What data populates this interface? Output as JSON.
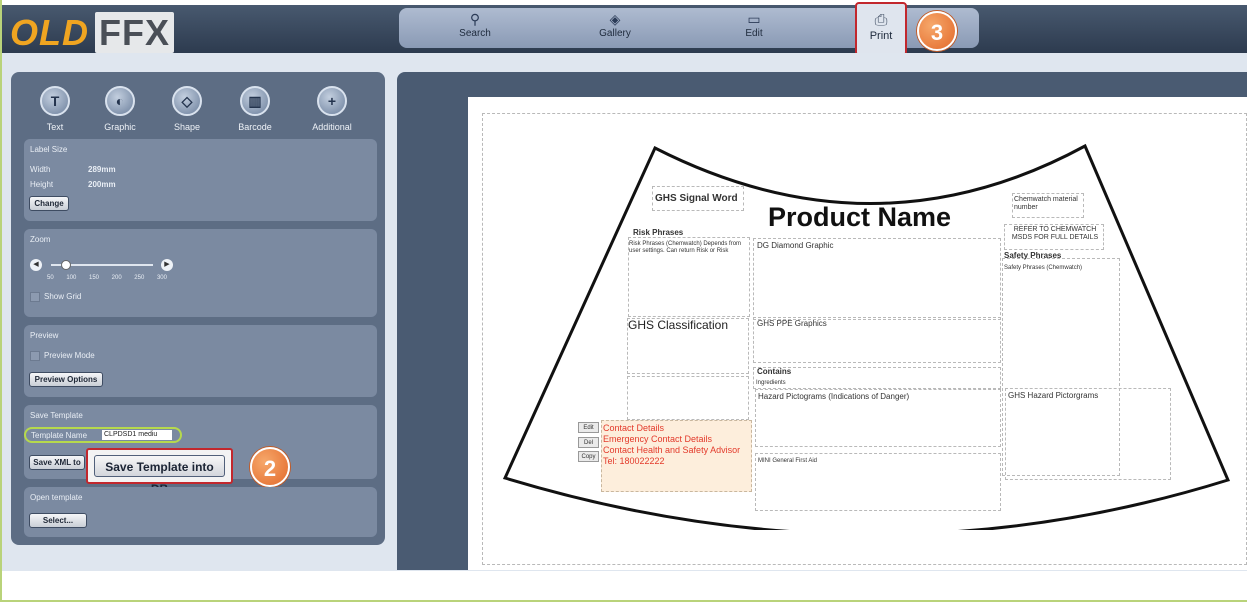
{
  "app": {
    "logo_part1": "OLD",
    "logo_part2": "FFX"
  },
  "nav": [
    {
      "label": "Search",
      "icon": "search-icon"
    },
    {
      "label": "Gallery",
      "icon": "gallery-icon"
    },
    {
      "label": "Edit",
      "icon": "edit-icon"
    }
  ],
  "print": {
    "label": "Print",
    "icon": "printer-icon"
  },
  "badges": {
    "two": "2",
    "three": "3"
  },
  "tools": [
    "Text",
    "Graphic",
    "Shape",
    "Barcode",
    "Additional"
  ],
  "label_size": {
    "title": "Label Size",
    "width_label": "Width",
    "width_value": "289mm",
    "height_label": "Height",
    "height_value": "200mm",
    "change_button": "Change"
  },
  "zoom": {
    "title": "Zoom",
    "ticks": [
      "50",
      "100",
      "150",
      "200",
      "250",
      "300"
    ],
    "show_grid": "Show Grid"
  },
  "preview": {
    "title": "Preview",
    "mode": "Preview Mode",
    "options_button": "Preview Options"
  },
  "save_template": {
    "title": "Save Template",
    "name_label": "Template Name",
    "name_value": "CLPDSD1 mediu",
    "save_xml": "Save XML to",
    "save_db": "Save Template into DB"
  },
  "open_template": {
    "title": "Open template",
    "select_button": "Select..."
  },
  "label": {
    "signal_word": "GHS Signal Word",
    "product_name": "Product Name",
    "chemwatch": "Chemwatch material number",
    "refer": "REFER TO CHEMWATCH MSDS FOR FULL DETAILS",
    "risk_title": "Risk Phrases",
    "risk_text": "Risk Phrases (Chemwatch) Depends from user settings. Can return Risk or Risk",
    "dg_diamond": "DG Diamond Graphic",
    "safety_title": "Safety Phrases",
    "safety_text": "Safety Phrases (Chemwatch)",
    "ghs_class": "GHS Classification",
    "ppe": "GHS PPE Graphics",
    "contains": "Contains",
    "ingredients": "Ingredients",
    "hazard_pictograms": "Hazard Pictograms (Indications of Danger)",
    "ghs_hazard": "GHS Hazard Pictorgrams",
    "contact_details": "Contact Details",
    "emergency": "Emergency Contact Details",
    "health_safety": "Contact Health and Safety Advisor",
    "tel": "Tel: 180022222",
    "first_aid": "MINI General First Aid",
    "edit_btn": "Edit",
    "del_btn": "Del",
    "copy_btn": "Copy"
  }
}
